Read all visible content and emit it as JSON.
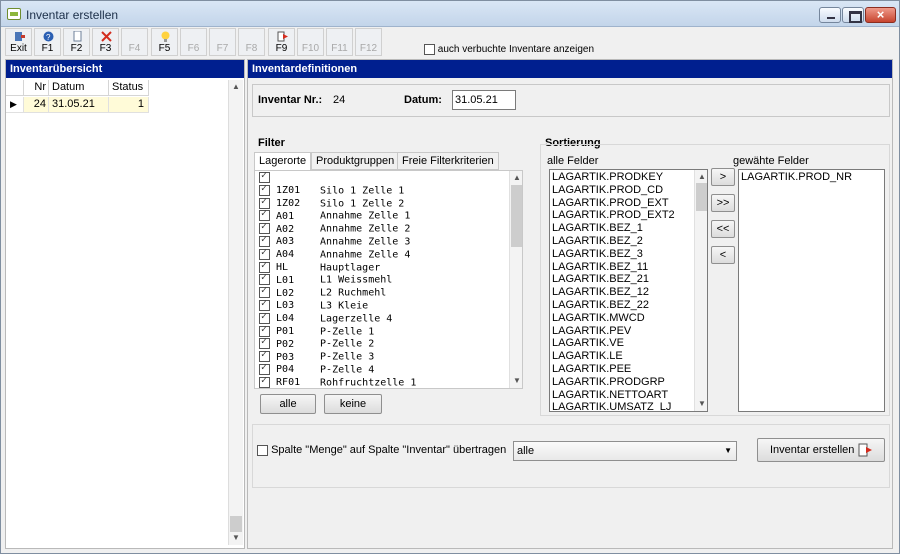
{
  "window": {
    "title": "Inventar erstellen",
    "close_label": "×"
  },
  "toolbar": {
    "buttons": [
      {
        "label": "Exit",
        "icon": "exit-icon",
        "enabled": true
      },
      {
        "label": "F1",
        "icon": "help-icon",
        "enabled": true
      },
      {
        "label": "F2",
        "icon": "new-document-icon",
        "enabled": true
      },
      {
        "label": "F3",
        "icon": "delete-icon",
        "enabled": true
      },
      {
        "label": "F4",
        "icon": "",
        "enabled": false
      },
      {
        "label": "F5",
        "icon": "lightbulb-icon",
        "enabled": true
      },
      {
        "label": "F6",
        "icon": "",
        "enabled": false
      },
      {
        "label": "F7",
        "icon": "",
        "enabled": false
      },
      {
        "label": "F8",
        "icon": "",
        "enabled": false
      },
      {
        "label": "F9",
        "icon": "create-icon",
        "enabled": true
      },
      {
        "label": "F10",
        "icon": "",
        "enabled": false
      },
      {
        "label": "F11",
        "icon": "",
        "enabled": false
      },
      {
        "label": "F12",
        "icon": "",
        "enabled": false
      }
    ],
    "checkbox_label": "auch verbuchte Inventare anzeigen",
    "checkbox_checked": false
  },
  "overview": {
    "title": "Inventarübersicht",
    "columns": [
      "Nr",
      "Datum",
      "Status"
    ],
    "rows": [
      {
        "nr": "24",
        "datum": "31.05.21",
        "status": "1",
        "selected": true
      }
    ]
  },
  "definitions": {
    "title": "Inventardefinitionen",
    "nr_label": "Inventar Nr.:",
    "nr_value": "24",
    "date_label": "Datum:",
    "date_value": "31.05.21"
  },
  "filter": {
    "title": "Filter",
    "tabs": [
      "Lagerorte",
      "Produktgruppen",
      "Freie Filterkriterien"
    ],
    "active_tab": "Lagerorte",
    "header_checked": true,
    "items": [
      {
        "code": "1Z01",
        "name": "Silo 1 Zelle 1",
        "checked": true
      },
      {
        "code": "1Z02",
        "name": "Silo 1 Zelle 2",
        "checked": true
      },
      {
        "code": "A01",
        "name": "Annahme Zelle 1",
        "checked": true
      },
      {
        "code": "A02",
        "name": "Annahme Zelle 2",
        "checked": true
      },
      {
        "code": "A03",
        "name": "Annahme Zelle 3",
        "checked": true
      },
      {
        "code": "A04",
        "name": "Annahme Zelle 4",
        "checked": true
      },
      {
        "code": "HL",
        "name": "Hauptlager",
        "checked": true
      },
      {
        "code": "L01",
        "name": "L1 Weissmehl",
        "checked": true
      },
      {
        "code": "L02",
        "name": "L2 Ruchmehl",
        "checked": true
      },
      {
        "code": "L03",
        "name": "L3 Kleie",
        "checked": true
      },
      {
        "code": "L04",
        "name": "Lagerzelle 4",
        "checked": true
      },
      {
        "code": "P01",
        "name": "P-Zelle 1",
        "checked": true
      },
      {
        "code": "P02",
        "name": "P-Zelle 2",
        "checked": true
      },
      {
        "code": "P03",
        "name": "P-Zelle 3",
        "checked": true
      },
      {
        "code": "P04",
        "name": "P-Zelle 4",
        "checked": true
      },
      {
        "code": "RF01",
        "name": "Rohfruchtzelle 1",
        "checked": true
      }
    ],
    "all_button": "alle",
    "none_button": "keine"
  },
  "sorting": {
    "title": "Sortierung",
    "all_fields_label": "alle Felder",
    "selected_fields_label": "gewähte Felder",
    "all_fields": [
      "LAGARTIK.PRODKEY",
      "LAGARTIK.PROD_CD",
      "LAGARTIK.PROD_EXT",
      "LAGARTIK.PROD_EXT2",
      "LAGARTIK.BEZ_1",
      "LAGARTIK.BEZ_2",
      "LAGARTIK.BEZ_3",
      "LAGARTIK.BEZ_11",
      "LAGARTIK.BEZ_21",
      "LAGARTIK.BEZ_12",
      "LAGARTIK.BEZ_22",
      "LAGARTIK.MWCD",
      "LAGARTIK.PEV",
      "LAGARTIK.VE",
      "LAGARTIK.LE",
      "LAGARTIK.PEE",
      "LAGARTIK.PRODGRP",
      "LAGARTIK.NETTOART",
      "LAGARTIK.UMSATZ_LJ"
    ],
    "selected_fields": [
      "LAGARTIK.PROD_NR"
    ],
    "move_buttons": [
      ">",
      ">>",
      "<<",
      "<"
    ]
  },
  "bottom": {
    "checkbox_label": "Spalte \"Menge\" auf Spalte \"Inventar\" übertragen",
    "checkbox_checked": false,
    "select_value": "alle",
    "create_button": "Inventar erstellen"
  }
}
